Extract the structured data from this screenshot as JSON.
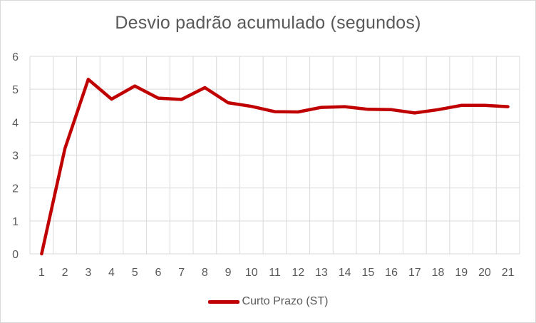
{
  "chart_data": {
    "type": "line",
    "title": "Desvio padrão acumulado (segundos)",
    "xlabel": "",
    "ylabel": "",
    "categories": [
      "1",
      "2",
      "3",
      "4",
      "5",
      "6",
      "7",
      "8",
      "9",
      "10",
      "11",
      "12",
      "13",
      "14",
      "15",
      "16",
      "17",
      "18",
      "19",
      "20",
      "21"
    ],
    "series": [
      {
        "name": "Curto Prazo (ST)",
        "color": "#c00000",
        "values": [
          0,
          3.2,
          5.3,
          4.7,
          5.1,
          4.73,
          4.69,
          5.05,
          4.59,
          4.48,
          4.32,
          4.31,
          4.45,
          4.47,
          4.39,
          4.38,
          4.28,
          4.38,
          4.51,
          4.51,
          4.47
        ]
      }
    ],
    "ylim": [
      0,
      6
    ],
    "yticks": [
      "0",
      "1",
      "2",
      "3",
      "4",
      "5",
      "6"
    ],
    "grid": true,
    "legend_position": "bottom"
  }
}
